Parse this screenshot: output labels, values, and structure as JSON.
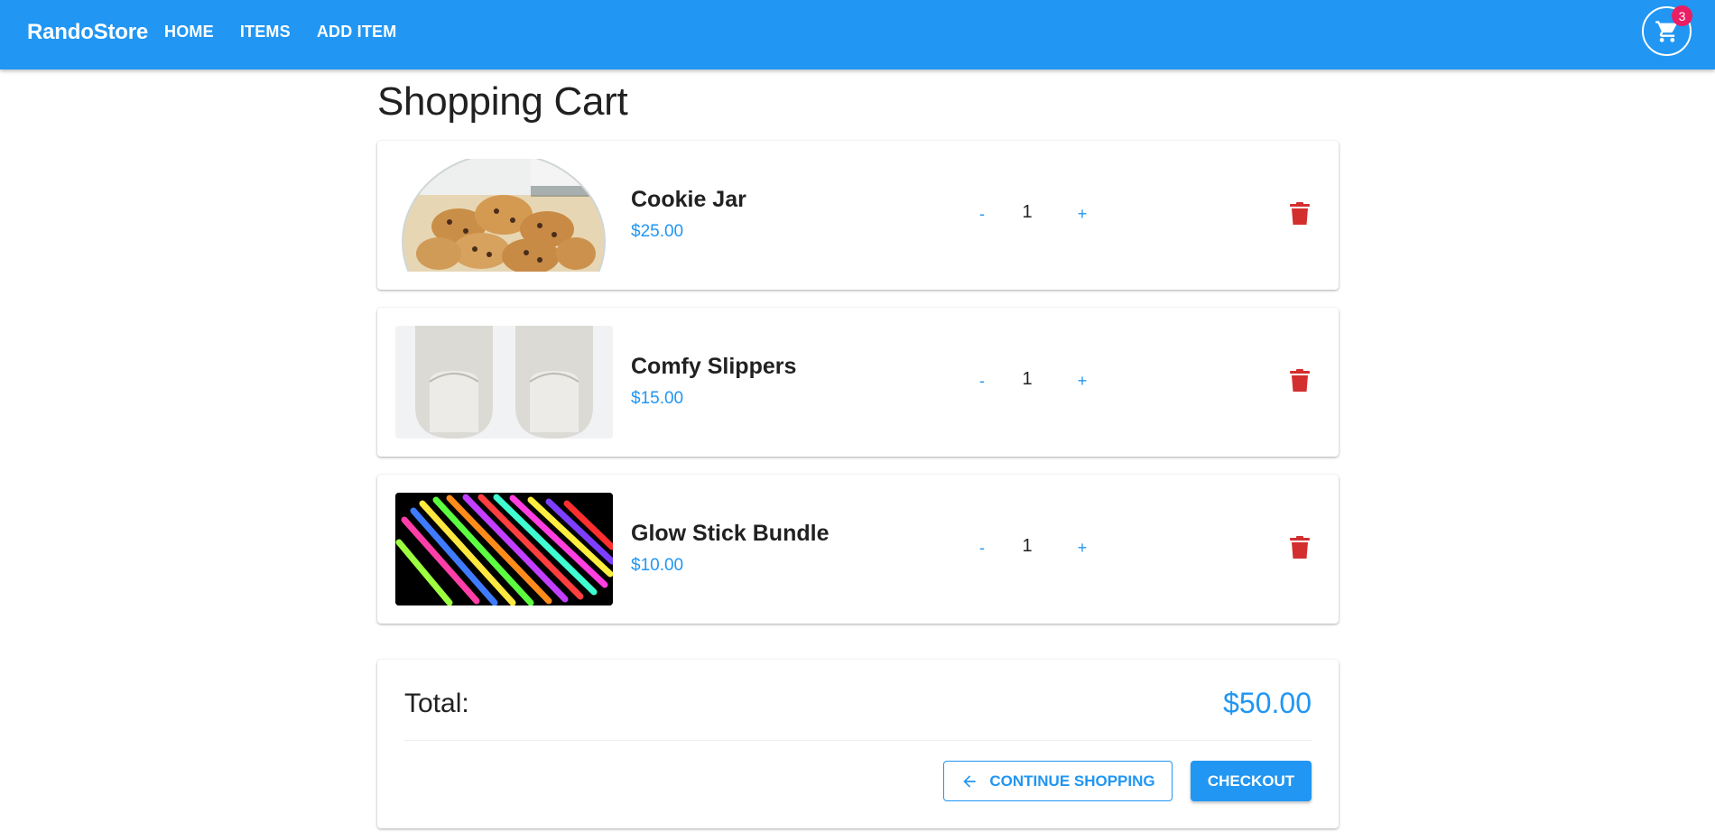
{
  "app": {
    "brand": "RandoStore"
  },
  "nav": {
    "items": [
      "HOME",
      "ITEMS",
      "ADD ITEM"
    ]
  },
  "cart": {
    "icon": "shopping-cart-icon",
    "count": "3"
  },
  "page": {
    "title": "Shopping Cart"
  },
  "items": [
    {
      "name": "Cookie Jar",
      "price": "$25.00",
      "quantity": "1",
      "minus": "-",
      "plus": "+",
      "image": "cookie-jar-image"
    },
    {
      "name": "Comfy Slippers",
      "price": "$15.00",
      "quantity": "1",
      "minus": "-",
      "plus": "+",
      "image": "slippers-image"
    },
    {
      "name": "Glow Stick Bundle",
      "price": "$10.00",
      "quantity": "1",
      "minus": "-",
      "plus": "+",
      "image": "glow-sticks-image"
    }
  ],
  "summary": {
    "total_label": "Total:",
    "total_value": "$50.00",
    "continue_label": "CONTINUE SHOPPING",
    "checkout_label": "CHECKOUT"
  },
  "colors": {
    "primary": "#2196f3",
    "delete": "#d32f2f",
    "badge": "#e91e63"
  }
}
